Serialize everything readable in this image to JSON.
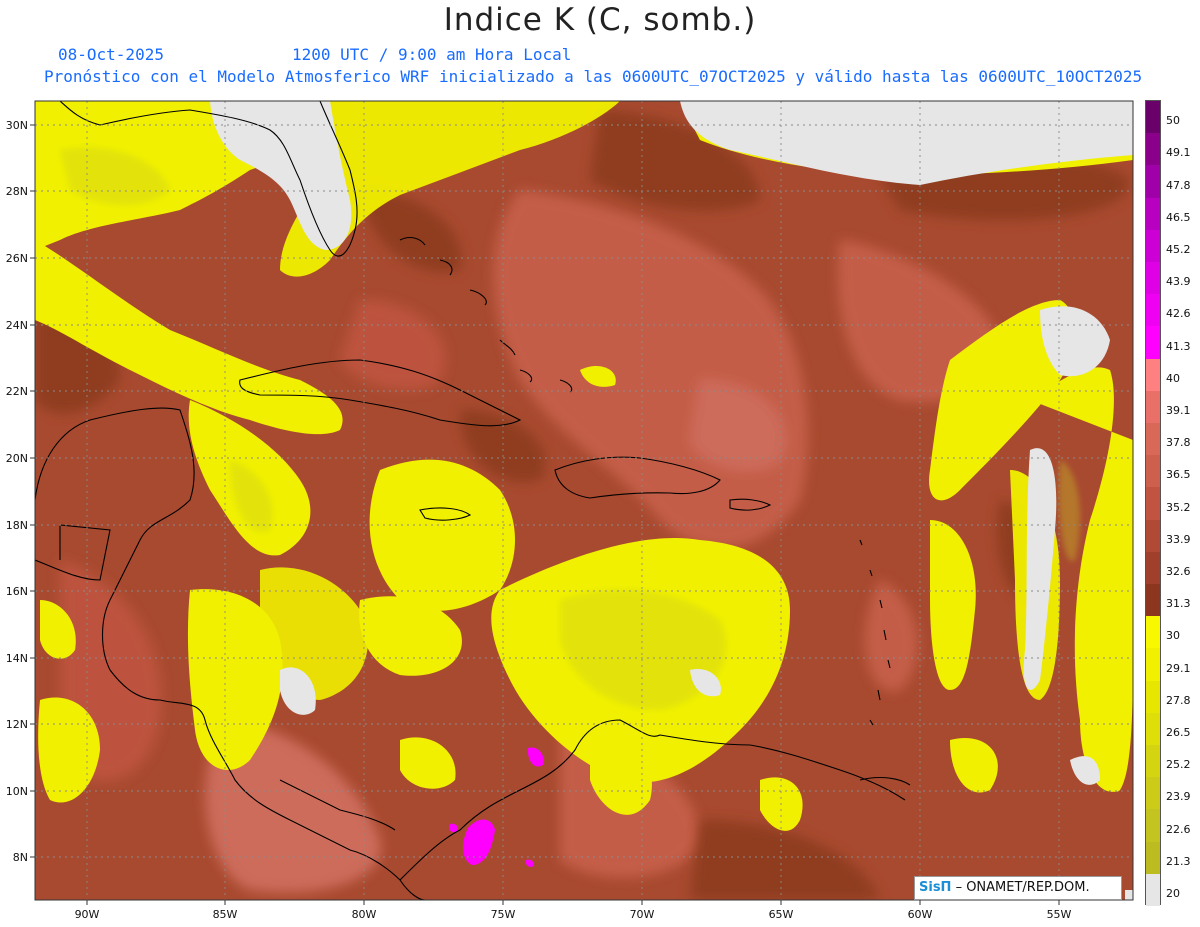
{
  "header": {
    "title": "Indice K (C, somb.)",
    "date": "08-Oct-2025",
    "time": "1200 UTC / 9:00 am Hora Local",
    "forecast": "Pronóstico con el Modelo Atmosferico WRF inicializado a las 0600UTC_07OCT2025 y válido hasta las  0600UTC_10OCT2025"
  },
  "map": {
    "lat_labels": [
      "30N",
      "28N",
      "26N",
      "24N",
      "22N",
      "20N",
      "18N",
      "16N",
      "14N",
      "12N",
      "10N",
      "8N"
    ],
    "lon_labels": [
      "90W",
      "85W",
      "80W",
      "75W",
      "70W",
      "65W",
      "60W",
      "55W"
    ],
    "field_colors": {
      "land_mask": "#e6e6e6",
      "yellow": "#f0f000",
      "olive": "#cccc22",
      "brown_dark": "#8b3a1c",
      "brown": "#a84a30",
      "salmon": "#c8604c",
      "pink_light": "#e07c70",
      "magenta": "#ff00ff"
    }
  },
  "colorbar": {
    "labels": [
      "50",
      "49.1",
      "47.8",
      "46.5",
      "45.2",
      "43.9",
      "42.6",
      "41.3",
      "40",
      "39.1",
      "37.8",
      "36.5",
      "35.2",
      "33.9",
      "32.6",
      "31.3",
      "30",
      "29.1",
      "27.8",
      "26.5",
      "25.2",
      "23.9",
      "22.6",
      "21.3",
      "20"
    ],
    "colors": [
      "#6a006a",
      "#8a008a",
      "#a000a8",
      "#b800c0",
      "#cc00d4",
      "#e000e6",
      "#f000f2",
      "#ff00ff",
      "#ff8080",
      "#e87068",
      "#d86858",
      "#cc604c",
      "#c05440",
      "#b04a34",
      "#a0402c",
      "#8c3620",
      "#f8f800",
      "#f0f000",
      "#e6e600",
      "#dede08",
      "#d4d410",
      "#cccc18",
      "#c4c420",
      "#bcbc20",
      "#e6e6e6"
    ]
  },
  "logo": {
    "brand": "SisΠ",
    "org": " – ONAMET/REP.DOM."
  }
}
